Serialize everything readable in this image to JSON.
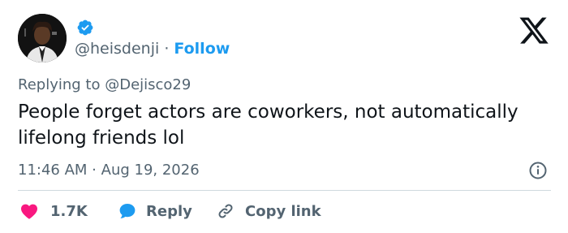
{
  "tweet": {
    "handle": "@heisdenji",
    "separator": "·",
    "follow_label": "Follow",
    "replying_to_prefix": "Replying to ",
    "replying_to_handle": "@Dejisco29",
    "text": "People forget actors are coworkers, not automatically lifelong friends lol",
    "time": "11:46 AM",
    "time_separator": " · ",
    "date": "Aug 19, 2026"
  },
  "actions": {
    "like_count": "1.7K",
    "reply_label": "Reply",
    "copy_link_label": "Copy link"
  },
  "icons": {
    "verified": "verified-badge-icon",
    "platform": "x-logo-icon",
    "info": "info-icon",
    "like": "heart-icon",
    "reply": "speech-bubble-icon",
    "copy": "link-icon"
  },
  "colors": {
    "accent": "#1d9bf0",
    "like": "#f91880",
    "muted": "#536471",
    "text": "#0f1419"
  }
}
